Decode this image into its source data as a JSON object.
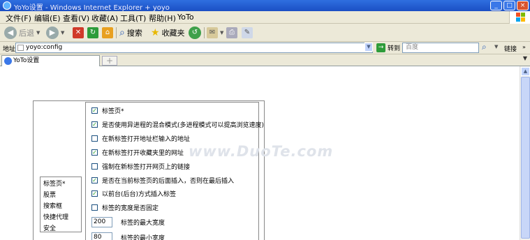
{
  "window": {
    "title": "YoYo设置 - Windows Internet Explorer + yoyo",
    "buttons": [
      "_",
      "□",
      "×"
    ]
  },
  "menu": [
    "文件(F)",
    "编辑(E)",
    "查看(V)",
    "收藏(A)",
    "工具(T)",
    "帮助(H)",
    "YoTo"
  ],
  "toolbar": {
    "back": "后退",
    "search": "搜索",
    "favorites": "收藏夹"
  },
  "address": {
    "label": "地址(D)",
    "url": "yoyo:config",
    "go": "转到",
    "search_placeholder": "百度",
    "links": "链接"
  },
  "tabs": [
    {
      "label": "YoTo设置"
    }
  ],
  "nav": [
    "标签页*",
    "股票",
    "搜索框",
    "快捷代理",
    "安全"
  ],
  "options": [
    {
      "label": "标签页*",
      "checked": true
    },
    {
      "label": "是否使用异进程的混合模式(多进程模式可以提高浏览速度)",
      "checked": true
    },
    {
      "label": "在新标签打开地址栏输入的地址",
      "checked": false
    },
    {
      "label": "在新标签打开收藏夹里的网址",
      "checked": true
    },
    {
      "label": "强制在新标签打开网页上的链接",
      "checked": false
    },
    {
      "label": "是否在当前标签页的后面插入，否则在最后插入",
      "checked": true
    },
    {
      "label": "以前台(后台)方式插入标签",
      "checked": true
    },
    {
      "label": "标签的宽度是否固定",
      "checked": false
    }
  ],
  "widths": [
    {
      "value": "200",
      "label": "标签的最大宽度"
    },
    {
      "value": "80",
      "label": "标签的最小宽度"
    }
  ],
  "watermark": "www.DuoTe.com",
  "check_glyph": "✓"
}
